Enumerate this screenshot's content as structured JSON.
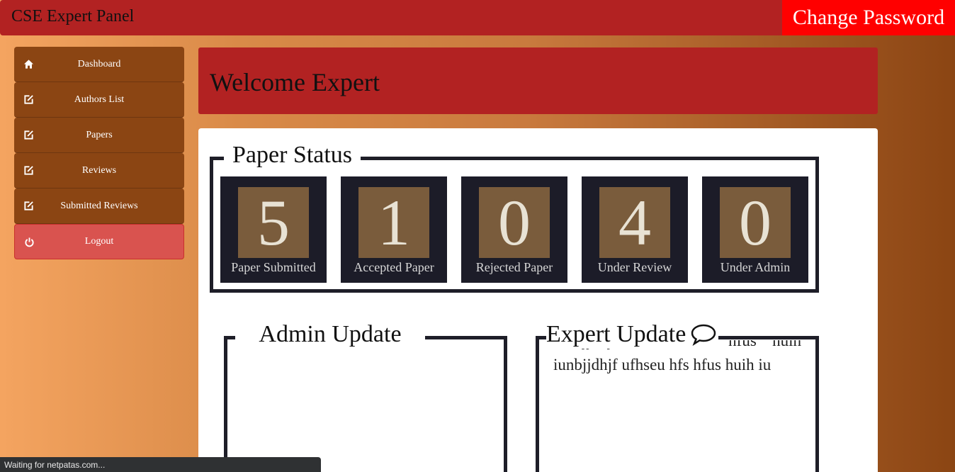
{
  "topbar": {
    "brand": "CSE Expert Panel",
    "change_password": "Change Password"
  },
  "sidebar": {
    "items": [
      {
        "label": "Dashboard",
        "icon": "home-icon"
      },
      {
        "label": "Authors List",
        "icon": "edit-icon"
      },
      {
        "label": "Papers",
        "icon": "edit-icon"
      },
      {
        "label": "Reviews",
        "icon": "edit-icon"
      },
      {
        "label": "Submitted Reviews",
        "icon": "edit-icon"
      },
      {
        "label": "Logout",
        "icon": "power-icon"
      }
    ]
  },
  "welcome": {
    "title": "Welcome Expert"
  },
  "paper_status": {
    "title": "Paper Status",
    "cards": [
      {
        "value": "5",
        "label": "Paper Submitted"
      },
      {
        "value": "1",
        "label": "Accepted Paper"
      },
      {
        "value": "0",
        "label": "Rejected Paper"
      },
      {
        "value": "4",
        "label": "Under Review"
      },
      {
        "value": "0",
        "label": "Under Admin"
      }
    ]
  },
  "admin_update": {
    "title": "Admin Update"
  },
  "expert_update": {
    "title": "Expert Update",
    "text": "iunbjjdhjf ufhseu hfs hfus huih iunbjjdhjf ufhseu hfs hfus huih iu"
  },
  "statusbar": {
    "text": "Waiting for netpatas.com..."
  },
  "colors": {
    "topbar": "#b22222",
    "change_password": "#ff0000",
    "nav": "#8b4513",
    "logout": "#d9534f",
    "card_bg": "#1c1c28",
    "card_num_bg": "#7a5c3c"
  }
}
